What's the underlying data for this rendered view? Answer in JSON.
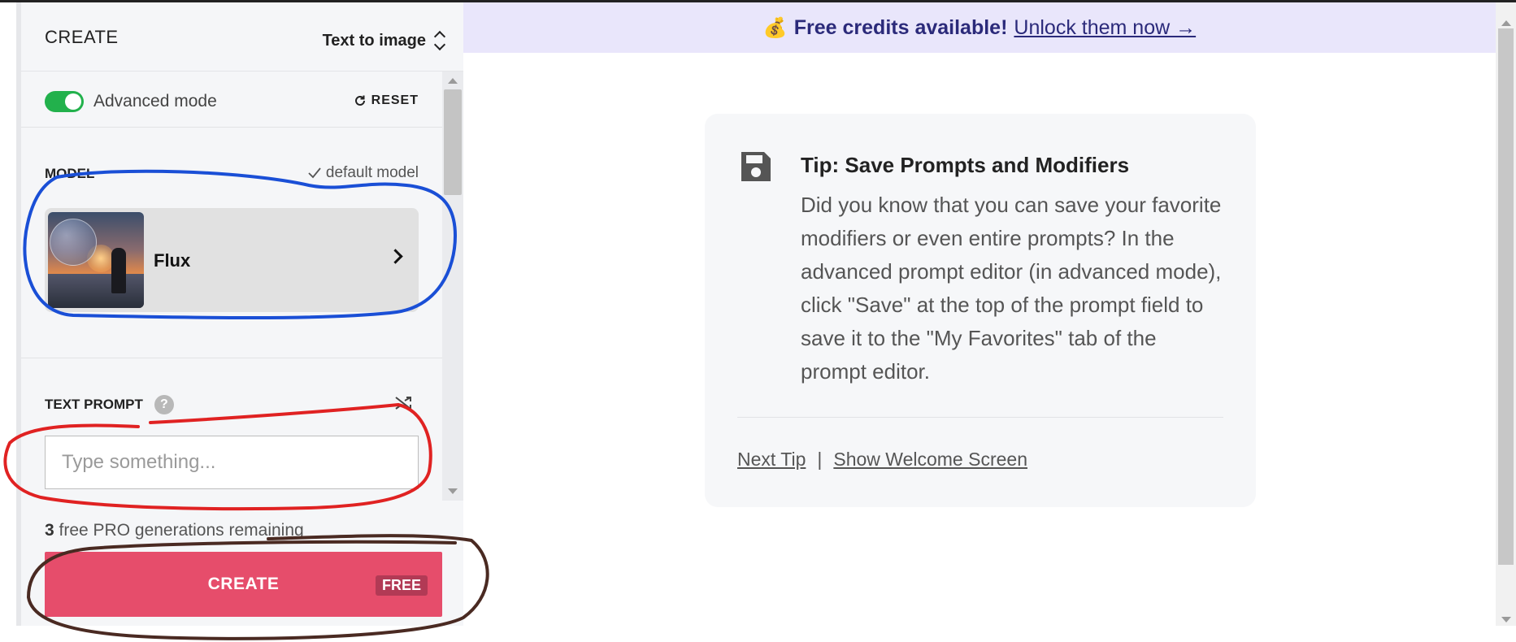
{
  "sidebar": {
    "header": {
      "title": "CREATE",
      "mode": "Text to image"
    },
    "advanced_mode": {
      "label": "Advanced mode",
      "enabled": true
    },
    "reset_label": "RESET",
    "model": {
      "section_label": "MODEL",
      "default_label": "default model",
      "name": "Flux"
    },
    "text_prompt": {
      "label": "TEXT PROMPT",
      "placeholder": "Type something...",
      "value": ""
    },
    "generations": {
      "count": "3",
      "text": "free PRO generations remaining"
    },
    "create_button": {
      "label": "CREATE",
      "badge": "FREE"
    }
  },
  "banner": {
    "text": "Free credits available!",
    "link": "Unlock them now →",
    "icon": "moneybag-icon"
  },
  "tip": {
    "title": "Tip: Save Prompts and Modifiers",
    "body": "Did you know that you can save your favorite modifiers or even entire prompts? In the advanced prompt editor (in advanced mode), click \"Save\" at the top of the prompt field to save it to the \"My Favorites\" tab of the prompt editor.",
    "next_tip": "Next Tip",
    "separator": "|",
    "welcome": "Show Welcome Screen",
    "icon": "floppy-disk-icon"
  },
  "colors": {
    "toggle_on": "#22b14c",
    "create_button": "#e64d6b",
    "banner_bg": "#e9e6fb",
    "annotation_blue": "#1a4fd6",
    "annotation_red": "#e02222",
    "annotation_brown": "#4a2a22"
  }
}
